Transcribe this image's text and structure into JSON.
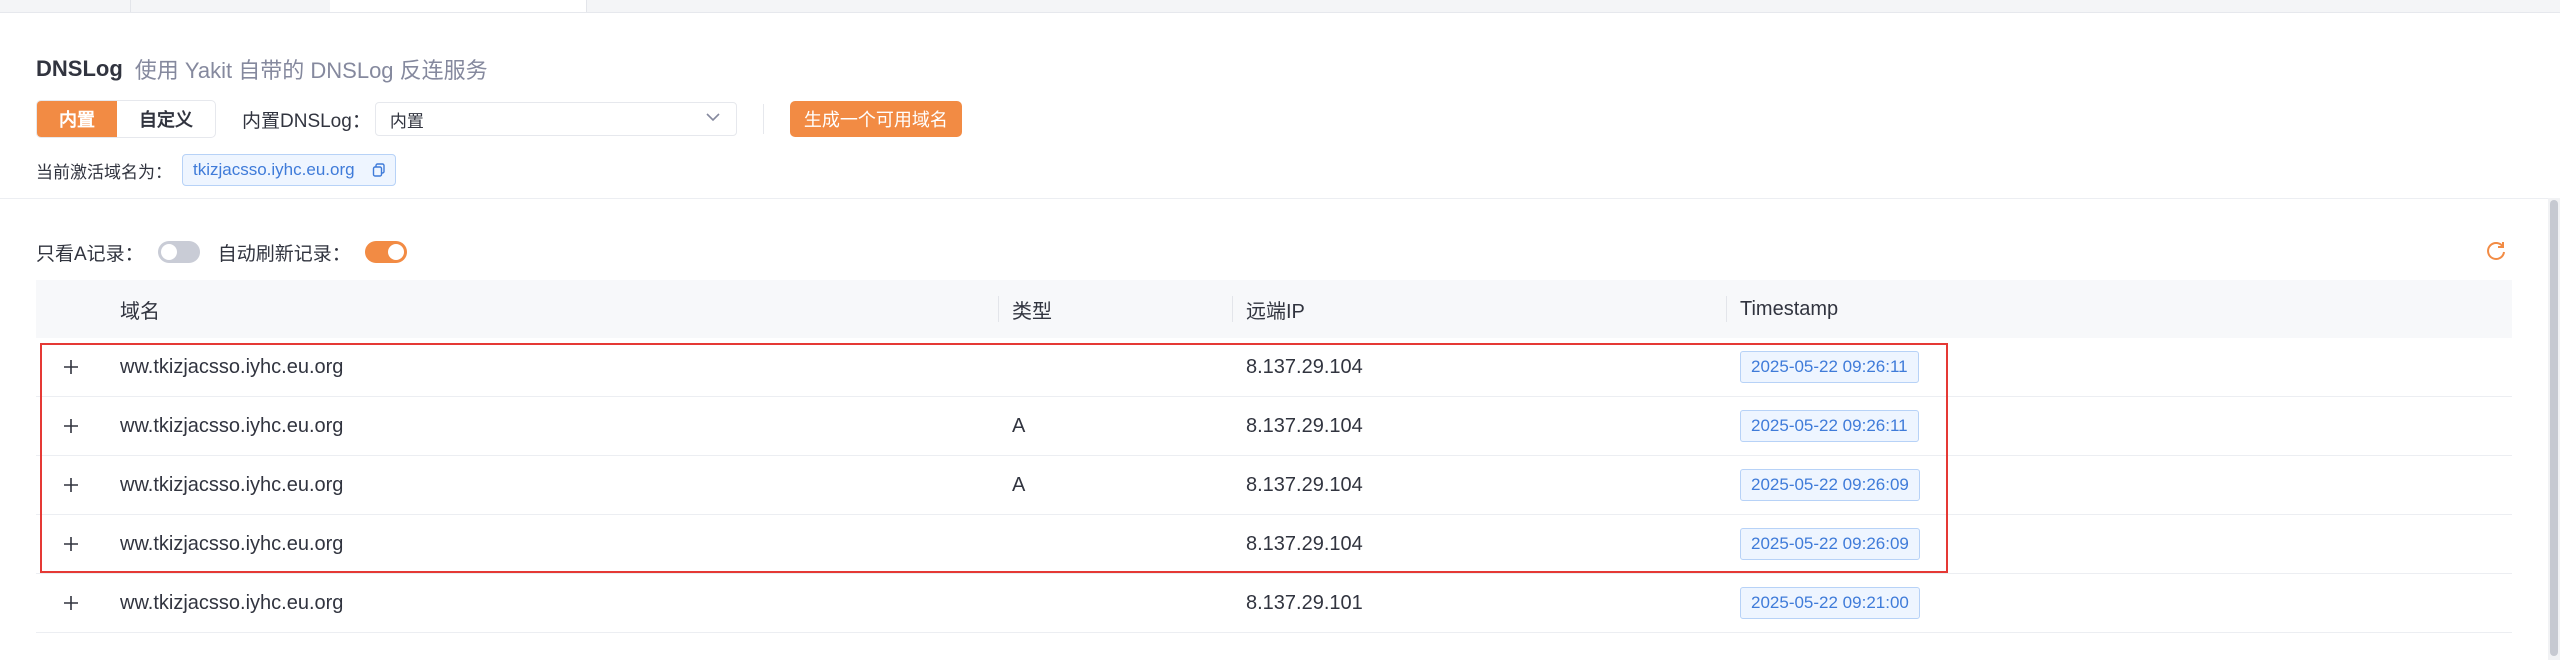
{
  "header": {
    "title": "DNSLog",
    "subtitle": "使用 Yakit 自带的 DNSLog 反连服务"
  },
  "mode_toggle": {
    "options": [
      "内置",
      "自定义"
    ],
    "selected": "内置"
  },
  "builtin_select": {
    "label": "内置DNSLog：",
    "value": "内置"
  },
  "generate_button": "生成一个可用域名",
  "active_domain": {
    "label": "当前激活域名为：",
    "value": "tkizjacsso.iyhc.eu.org"
  },
  "filters": {
    "only_a_label": "只看A记录：",
    "only_a_enabled": false,
    "auto_refresh_label": "自动刷新记录：",
    "auto_refresh_enabled": true
  },
  "colors": {
    "accent": "#f28b44",
    "tag_blue": "#3f7bd9",
    "highlight_red": "#e53935"
  },
  "table": {
    "columns": [
      "域名",
      "类型",
      "远端IP",
      "Timestamp"
    ],
    "rows": [
      {
        "domain": "ww.tkizjacsso.iyhc.eu.org",
        "type": "",
        "ip": "8.137.29.104",
        "timestamp": "2025-05-22 09:26:11"
      },
      {
        "domain": "ww.tkizjacsso.iyhc.eu.org",
        "type": "A",
        "ip": "8.137.29.104",
        "timestamp": "2025-05-22 09:26:11"
      },
      {
        "domain": "ww.tkizjacsso.iyhc.eu.org",
        "type": "A",
        "ip": "8.137.29.104",
        "timestamp": "2025-05-22 09:26:09"
      },
      {
        "domain": "ww.tkizjacsso.iyhc.eu.org",
        "type": "",
        "ip": "8.137.29.104",
        "timestamp": "2025-05-22 09:26:09"
      },
      {
        "domain": "ww.tkizjacsso.iyhc.eu.org",
        "type": "",
        "ip": "8.137.29.101",
        "timestamp": "2025-05-22 09:21:00"
      }
    ]
  }
}
